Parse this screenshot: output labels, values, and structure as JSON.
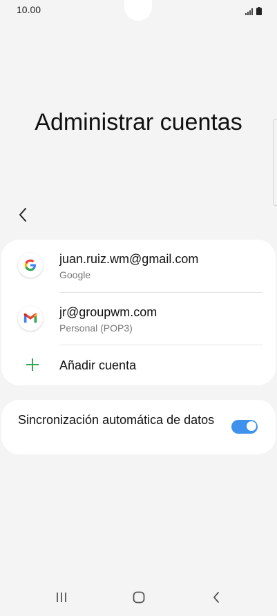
{
  "status_bar": {
    "time": "10.00",
    "icons": [
      "signal-icon",
      "battery-icon"
    ]
  },
  "header": {
    "title": "Administrar cuentas"
  },
  "accounts": [
    {
      "email": "juan.ruiz.wm@gmail.com",
      "type": "Google",
      "icon": "google-logo-icon"
    },
    {
      "email": "jr@groupwm.com",
      "type": "Personal (POP3)",
      "icon": "gmail-logo-icon"
    }
  ],
  "add_account": {
    "label": "Añadir cuenta",
    "icon": "plus-icon"
  },
  "sync": {
    "label": "Sincronización automática de datos",
    "enabled": true
  },
  "nav": {
    "buttons": [
      "recents-icon",
      "home-icon",
      "back-icon"
    ]
  },
  "colors": {
    "background": "#f4f4f4",
    "card": "#ffffff",
    "accent": "#3e91ec",
    "add_icon": "#2fa84f",
    "secondary_text": "#777777"
  }
}
